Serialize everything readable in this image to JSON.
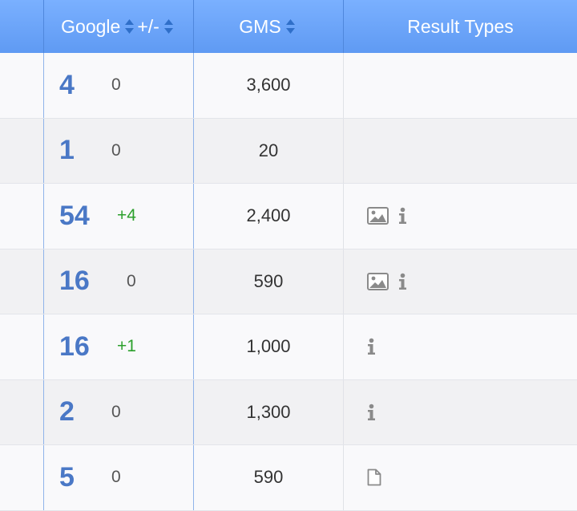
{
  "header": {
    "google_label": "Google",
    "change_label": "+/-",
    "gms_label": "GMS",
    "result_types_label": "Result Types"
  },
  "rows": [
    {
      "rank": "4",
      "change": "0",
      "gms": "3,600",
      "result_types": []
    },
    {
      "rank": "1",
      "change": "0",
      "gms": "20",
      "result_types": []
    },
    {
      "rank": "54",
      "change": "+4",
      "gms": "2,400",
      "result_types": [
        "image-icon",
        "info-icon"
      ]
    },
    {
      "rank": "16",
      "change": "0",
      "gms": "590",
      "result_types": [
        "image-icon",
        "info-icon"
      ]
    },
    {
      "rank": "16",
      "change": "+1",
      "gms": "1,000",
      "result_types": [
        "info-icon"
      ]
    },
    {
      "rank": "2",
      "change": "0",
      "gms": "1,300",
      "result_types": [
        "info-icon"
      ]
    },
    {
      "rank": "5",
      "change": "0",
      "gms": "590",
      "result_types": [
        "document-icon"
      ]
    }
  ],
  "colors": {
    "header_gradient_top": "#7ab0ff",
    "header_gradient_bottom": "#5f9af3",
    "rank_blue": "#4a78c6",
    "positive_change_green": "#2ca02c",
    "row_alt_bg": "#f1f1f3"
  }
}
